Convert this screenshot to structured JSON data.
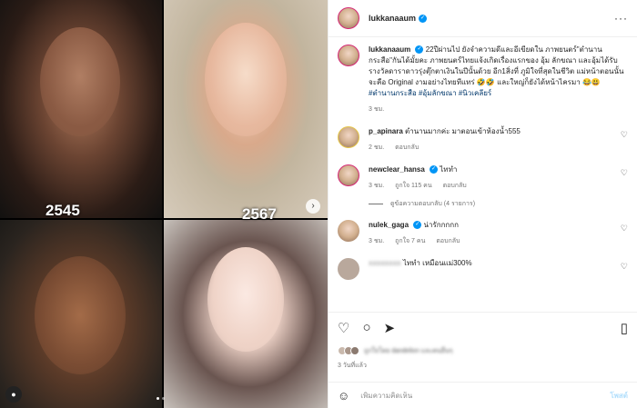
{
  "media": {
    "year_left": "2545",
    "year_right": "2567",
    "next_icon": "›",
    "user_icon": "●"
  },
  "post": {
    "username": "lukkanaaum",
    "verified_icon": "✓",
    "more_icon": "···",
    "caption_text": "22ปีผ่านไป ยังจำความดีและอีเขียดใน ภาพยนตร์\"ตำนานกระสือ\"กันได้มั้ยคะ ภาพยนตร์ไทยแจ้งเกิดเรื่องแรกของ อุ้ม ลักขณา และอุ้มได้รับรางวัลดาราดาวรุ่งตุ๊กตาเงินในปีนั้นด้วย อีก1สิ่งที่ ภูมิใจที่สุดในชีวิต แม่หน้าตอนนั้นจะคือ Original งามอย่างไทยทีแทร่ 🤣🤣 และใหญ่ก็ยังได้หน้าไครมา 😂😃",
    "hashtag1": "#ตำนานกระสือ",
    "hashtag2": "#อุ้มลักขณา",
    "hashtag3": "#นิวเคลียร์",
    "caption_time": "3 ชม."
  },
  "comments": [
    {
      "username": "p_apinara",
      "text": "ตำนานมากค่ะ มาตอนเข้าห้องน้ำ555",
      "time": "2 ชม.",
      "reply": "ตอบกลับ",
      "likes": ""
    },
    {
      "username": "newclear_hansa",
      "text": "ไททำ",
      "time": "3 ชม.",
      "reply": "ตอบกลับ",
      "likes": "ถูกใจ 115 คน"
    },
    {
      "username": "nulek_gaga",
      "text": "น่ารักกกกก",
      "time": "3 ชม.",
      "reply": "ตอบกลับ",
      "likes": "ถูกใจ 7 คน"
    },
    {
      "username": "xxxxxxxx",
      "text": "ไททำ เหมือนแม่300%",
      "time": "",
      "reply": "",
      "likes": ""
    }
  ],
  "view_replies": "ดูข้อความตอบกลับ (4 รายการ)",
  "actions": {
    "heart_icon": "♡",
    "comment_icon": "○",
    "share_icon": "➤",
    "bookmark_icon": "▯"
  },
  "likes_text": "ถูกใจโดย dandelion และคนอื่นๆ",
  "post_time": "3 วันที่แล้ว",
  "composer": {
    "emoji_icon": "☺",
    "placeholder": "เพิ่มความคิดเห็น",
    "post_label": "โพสต์"
  },
  "heart_small_icon": "♡",
  "colors": {
    "verified": "#0095f6",
    "link": "#00376b",
    "post_button": "#b2dffc"
  }
}
